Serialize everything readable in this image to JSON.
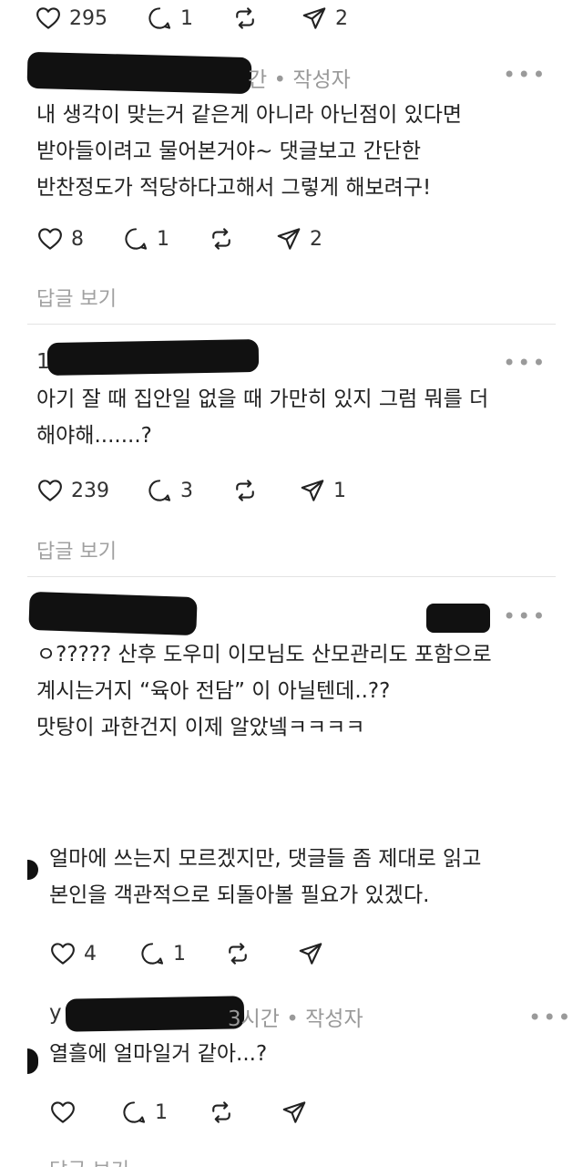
{
  "top_bar": {
    "likes": "295",
    "comments": "1",
    "shares": "2"
  },
  "posts": [
    {
      "header_suffix": "간 • 작성자",
      "lines": [
        "내 생각이 맞는거 같은게 아니라 아닌점이 있다면",
        "받아들이려고 물어본거야~ 댓글보고 간단한",
        "반찬정도가 적당하다고해서 그렇게 해보려구!"
      ],
      "likes": "8",
      "comments": "1",
      "shares": "2",
      "reply_link": "답글 보기"
    },
    {
      "header_prefix": "1",
      "lines": [
        "아기 잘 때 집안일 없을 때 가만히 있지 그럼 뭐를 더",
        "해야해.......?"
      ],
      "likes": "239",
      "comments": "3",
      "shares": "1",
      "reply_link": "답글 보기"
    },
    {
      "lines": [
        "ㅇ????? 산후 도우미 이모님도 산모관리도 포함으로",
        "계시는거지 “육아 전담” 이 아닐텐데..??",
        "맛탕이 과한건지 이제 알았넼ㅋㅋㅋㅋ"
      ]
    },
    {
      "lines": [
        "얼마에 쓰는지 모르겠지만, 댓글들 좀 제대로 읽고",
        "본인을 객관적으로 되돌아볼 필요가 있겠다."
      ],
      "likes": "4",
      "comments": "1"
    },
    {
      "header_prefix": "y",
      "header_suffix": "3시간 • 작성자",
      "lines": [
        "열흘에 얼마일거 같아...?"
      ],
      "comments": "1",
      "reply_link_partial": "답글 보기"
    }
  ]
}
